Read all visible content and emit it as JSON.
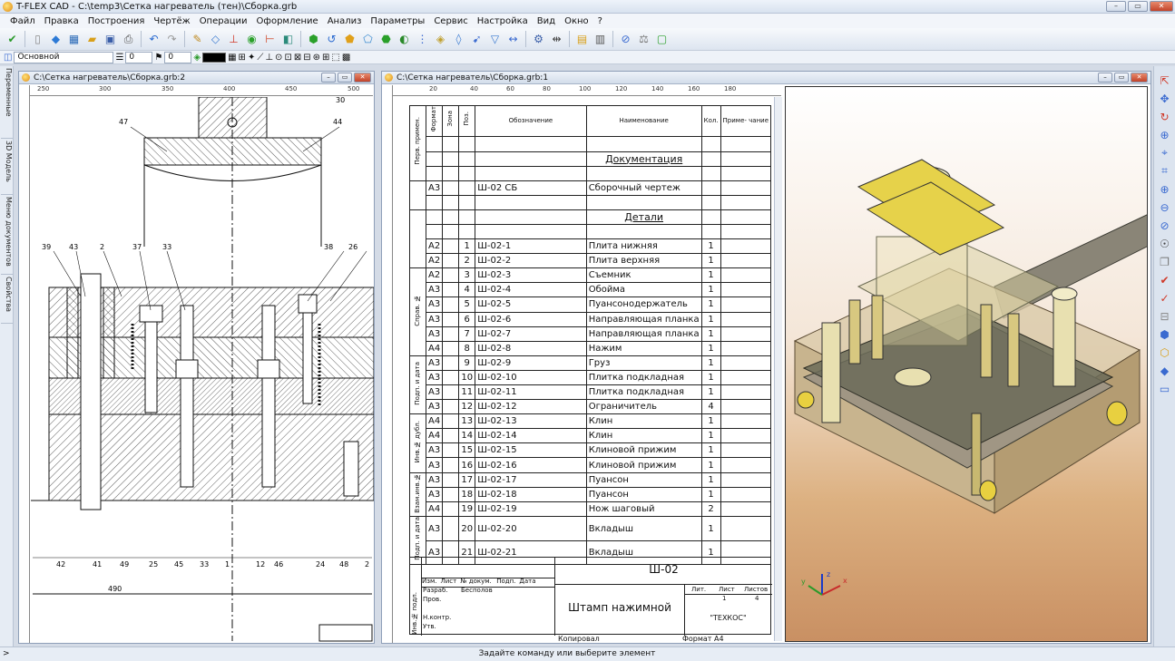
{
  "app": {
    "title": "T-FLEX CAD - C:\\temp3\\Сетка нагреватель (тен)\\Сборка.grb",
    "win_min": "–",
    "win_max": "▭",
    "win_close": "✕"
  },
  "menu": [
    "Файл",
    "Правка",
    "Построения",
    "Чертёж",
    "Операции",
    "Оформление",
    "Анализ",
    "Параметры",
    "Сервис",
    "Настройка",
    "Вид",
    "Окно",
    "?"
  ],
  "toolbar2": {
    "layer": "Основной",
    "line_value": "0",
    "level_value": "0"
  },
  "left_tabs": [
    "Переменные",
    "3D Модель",
    "Меню документов",
    "Свойства"
  ],
  "doc_left": {
    "title": "C:\\Сетка нагреватель\\Сборка.grb:2",
    "ruler_marks": [
      "250",
      "300",
      "350",
      "400",
      "450",
      "500"
    ],
    "balloons_top": [
      "47",
      "44",
      "39",
      "43",
      "2",
      "37",
      "33",
      "38",
      "26",
      "30"
    ],
    "balloons_bottom": [
      "42",
      "41",
      "49",
      "25",
      "45",
      "33",
      "1",
      "12",
      "46",
      "24",
      "48",
      "2"
    ],
    "dimension": "490"
  },
  "doc_right": {
    "title": "C:\\Сетка нагреватель\\Сборка.grb:1",
    "ruler_marks": [
      "20",
      "40",
      "60",
      "80",
      "100",
      "120",
      "140",
      "160",
      "180"
    ]
  },
  "spec": {
    "headers": {
      "format": "Формат",
      "zone": "Зона",
      "pos": "Поз.",
      "designation": "Обозначение",
      "name": "Наименование",
      "qty": "Кол.",
      "note": "Приме-\nчание"
    },
    "side_labels": [
      "Перв. примен.",
      "Справ. №",
      "Подп. и дата",
      "Инв.№ дубл.",
      "Взам.инв.№",
      "Подп. и дата",
      "Инв.№ подл."
    ],
    "section_docs": "Документация",
    "doc_row": {
      "format": "А3",
      "designation": "Ш-02 СБ",
      "name": "Сборочный чертеж"
    },
    "section_parts": "Детали",
    "rows": [
      {
        "format": "А2",
        "pos": "1",
        "designation": "Ш-02-1",
        "name": "Плита нижняя",
        "qty": "1"
      },
      {
        "format": "А2",
        "pos": "2",
        "designation": "Ш-02-2",
        "name": "Плита верхняя",
        "qty": "1"
      },
      {
        "format": "А2",
        "pos": "3",
        "designation": "Ш-02-3",
        "name": "Съемник",
        "qty": "1"
      },
      {
        "format": "А3",
        "pos": "4",
        "designation": "Ш-02-4",
        "name": "Обойма",
        "qty": "1"
      },
      {
        "format": "А3",
        "pos": "5",
        "designation": "Ш-02-5",
        "name": "Пуансонодержатель",
        "qty": "1"
      },
      {
        "format": "А3",
        "pos": "6",
        "designation": "Ш-02-6",
        "name": "Направляющая планка",
        "qty": "1"
      },
      {
        "format": "А3",
        "pos": "7",
        "designation": "Ш-02-7",
        "name": "Направляющая планка",
        "qty": "1"
      },
      {
        "format": "А4",
        "pos": "8",
        "designation": "Ш-02-8",
        "name": "Нажим",
        "qty": "1"
      },
      {
        "format": "А3",
        "pos": "9",
        "designation": "Ш-02-9",
        "name": "Груз",
        "qty": "1"
      },
      {
        "format": "А3",
        "pos": "10",
        "designation": "Ш-02-10",
        "name": "Плитка подкладная",
        "qty": "1"
      },
      {
        "format": "А3",
        "pos": "11",
        "designation": "Ш-02-11",
        "name": "Плитка подкладная",
        "qty": "1"
      },
      {
        "format": "А3",
        "pos": "12",
        "designation": "Ш-02-12",
        "name": "Ограничитель",
        "qty": "4"
      },
      {
        "format": "А4",
        "pos": "13",
        "designation": "Ш-02-13",
        "name": "Клин",
        "qty": "1"
      },
      {
        "format": "А4",
        "pos": "14",
        "designation": "Ш-02-14",
        "name": "Клин",
        "qty": "1"
      },
      {
        "format": "А3",
        "pos": "15",
        "designation": "Ш-02-15",
        "name": "Клиновой прижим",
        "qty": "1"
      },
      {
        "format": "А3",
        "pos": "16",
        "designation": "Ш-02-16",
        "name": "Клиновой прижим",
        "qty": "1"
      },
      {
        "format": "А3",
        "pos": "17",
        "designation": "Ш-02-17",
        "name": "Пуансон",
        "qty": "1"
      },
      {
        "format": "А3",
        "pos": "18",
        "designation": "Ш-02-18",
        "name": "Пуансон",
        "qty": "1"
      },
      {
        "format": "А4",
        "pos": "19",
        "designation": "Ш-02-19",
        "name": "Нож шаговый",
        "qty": "2"
      },
      {
        "format": "А3",
        "pos": "20",
        "designation": "Ш-02-20",
        "name": "Вкладыш",
        "qty": "1"
      },
      {
        "format": "А3",
        "pos": "21",
        "designation": "Ш-02-21",
        "name": "Вкладыш",
        "qty": "1"
      }
    ]
  },
  "stamp": {
    "designation": "Ш-02",
    "title": "Штамп нажимной",
    "company": "\"ТЕХКОС\"",
    "izm": "Изм.",
    "list": "Лист",
    "doc_no": "№ докум.",
    "sign": "Подп.",
    "date": "Дата",
    "razrab": "Разраб.",
    "razrab_name": "Бесполов",
    "prov": "Пров.",
    "nkontr": "Н.контр.",
    "utv": "Утв.",
    "lit": "Лит.",
    "sheet": "Лист",
    "sheets": "Листов",
    "sheet_val": "1",
    "sheets_val": "4",
    "copied": "Копировал",
    "format": "Формат А4"
  },
  "status": {
    "prompt": ">",
    "message": "Задайте команду или выберите элемент"
  },
  "axes": {
    "x": "x",
    "y": "y",
    "z": "z"
  },
  "colors": {
    "accent": "#316ac5",
    "metal": "#5a5a4e",
    "brass": "#e6d24a",
    "bg_bottom": "#c99063"
  }
}
